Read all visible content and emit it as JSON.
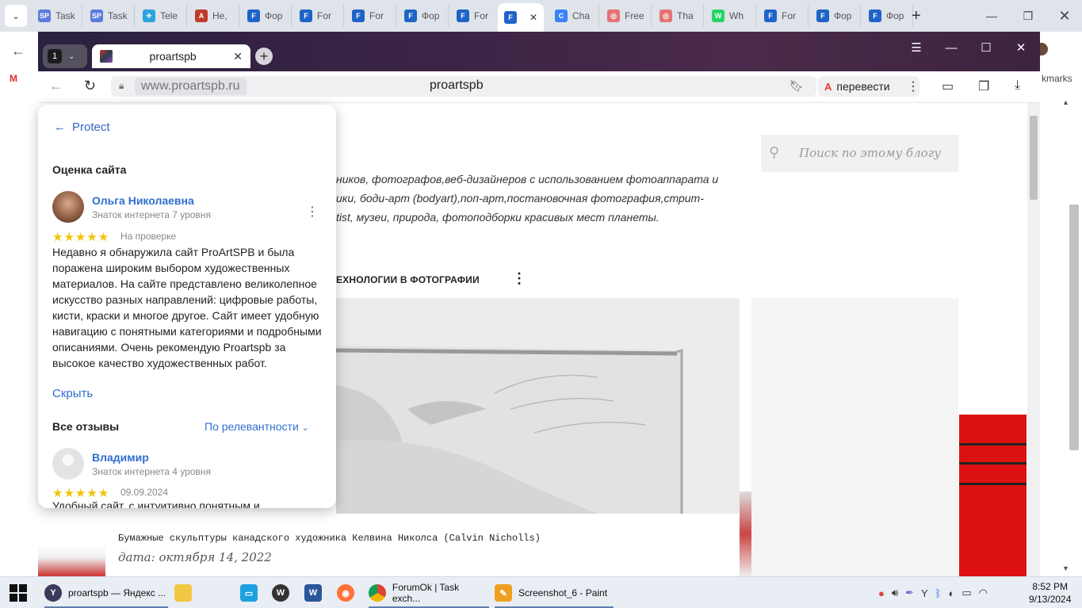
{
  "chrome": {
    "tabs": [
      {
        "label": "Task",
        "fav": "SP",
        "color": "#5c7cdb"
      },
      {
        "label": "Task",
        "fav": "SP",
        "color": "#5c7cdb"
      },
      {
        "label": "Tele",
        "fav": "✈",
        "color": "#2aa3df"
      },
      {
        "label": "Не,",
        "fav": "A",
        "color": "#c0392b"
      },
      {
        "label": "Фор",
        "fav": "F",
        "color": "#1e64c8"
      },
      {
        "label": "For",
        "fav": "F",
        "color": "#1e64c8"
      },
      {
        "label": "For",
        "fav": "F",
        "color": "#1e64c8"
      },
      {
        "label": "Фор",
        "fav": "F",
        "color": "#1e64c8"
      },
      {
        "label": "For",
        "fav": "F",
        "color": "#1e64c8"
      },
      {
        "label": "",
        "fav": "F",
        "color": "#1e64c8"
      },
      {
        "label": "Cha",
        "fav": "C",
        "color": "#3b82f6"
      },
      {
        "label": "Free",
        "fav": "◎",
        "color": "#e57373"
      },
      {
        "label": "Tha",
        "fav": "◎",
        "color": "#e57373"
      },
      {
        "label": "Wh",
        "fav": "W",
        "color": "#25d366"
      },
      {
        "label": "For",
        "fav": "F",
        "color": "#1e64c8"
      },
      {
        "label": "Фор",
        "fav": "F",
        "color": "#1e64c8"
      },
      {
        "label": "Фор",
        "fav": "F",
        "color": "#1e64c8"
      }
    ],
    "bookmarks_text": "kmarks"
  },
  "yandex": {
    "tab_count": "1",
    "tab_title": "proartspb",
    "url": "www.proartspb.ru",
    "page_title": "proartspb",
    "translate_label": "перевести"
  },
  "page": {
    "search_placeholder": "Поиск по этому блогу",
    "description_lines": [
      "ников, фотографов,веб-дизайнеров с использованием фотоаппарата и",
      "ики, боди-арт (bodyart),поп-арт,постановочная фотография,стрит-",
      "tist, музеи, природа, фотоподборки красивых мест планеты."
    ],
    "section_title": "ЕХНОЛОГИИ В ФОТОГРАФИИ",
    "post_title": "Бумажные скульптуры канадского художника Келвина Николса (Calvin Nicholls)",
    "post_date": "дата: октября 14, 2022"
  },
  "protect": {
    "back_label": "Protect",
    "heading": "Оценка сайта",
    "review1": {
      "name": "Ольга Николаевна",
      "level": "Знаток интернета 7 уровня",
      "stars": "★★★★★",
      "status": "На проверке",
      "text": "Недавно я обнаружила сайт ProArtSPB и была поражена широким выбором художественных материалов. На сайте представлено великолепное искусство разных направлений: цифровые работы, кисти, краски и многое другое. Сайт имеет удобную навигацию с понятными категориями и подробными описаниями. Очень рекомендую Proartspb за высокое качество художественных работ.",
      "hide_label": "Скрыть"
    },
    "all_reviews_label": "Все отзывы",
    "sort_label": "По релевантности",
    "review2": {
      "name": "Владимир",
      "level": "Знаток интернета 4 уровня",
      "stars": "★★★★★",
      "date": "09.09.2024",
      "text": "Удобный сайт, с интуитивно понятным и"
    }
  },
  "taskbar": {
    "items": [
      {
        "label": "proartspb — Яндекс ...",
        "icon": "Y",
        "color": "#3a3a5c"
      },
      {
        "label": "ForumOk | Task exch...",
        "icon": "◉",
        "color": "#db4437"
      },
      {
        "label": "Screenshot_6 - Paint",
        "icon": "🎨",
        "color": "#f0a020"
      }
    ],
    "time": "8:52 PM",
    "date": "9/13/2024"
  }
}
